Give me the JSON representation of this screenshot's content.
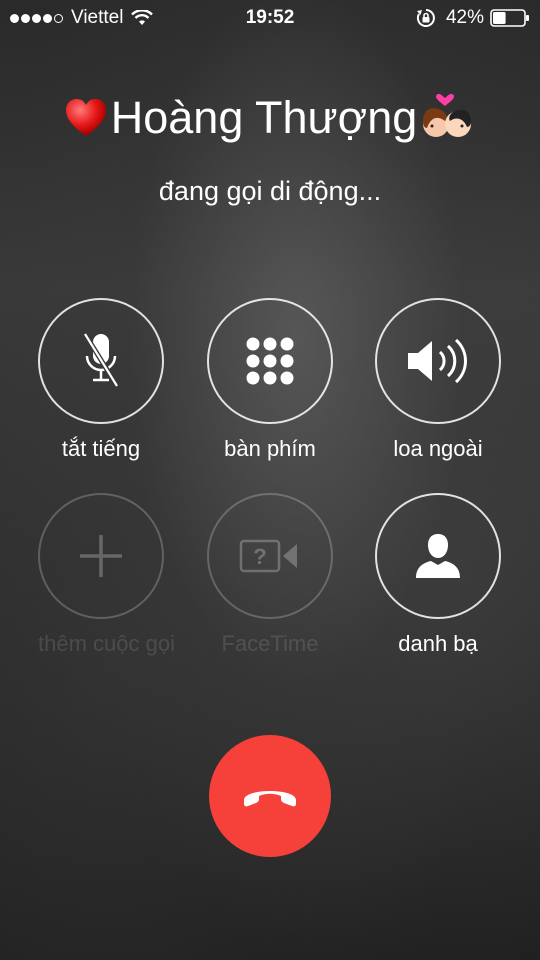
{
  "status_bar": {
    "signal_bars": 5,
    "signal_filled": 4,
    "carrier": "Viettel",
    "time": "19:52",
    "battery_percent": "42%",
    "battery_level": 0.42,
    "icons": [
      "wifi-icon",
      "rotation-lock-icon",
      "battery-icon"
    ]
  },
  "call": {
    "caller_name": "Hoàng Thượng",
    "caller_emoji_prefix": "heart-icon",
    "caller_emoji_suffix": "couple-kiss-icon",
    "status": "đang gọi di động..."
  },
  "controls": [
    {
      "id": "mute",
      "label": "tắt tiếng",
      "icon": "mute-mic-icon",
      "enabled": true
    },
    {
      "id": "keypad",
      "label": "bàn phím",
      "icon": "keypad-icon",
      "enabled": true
    },
    {
      "id": "speaker",
      "label": "loa ngoài",
      "icon": "speaker-icon",
      "enabled": true
    },
    {
      "id": "add_call",
      "label": "thêm cuộc gọi",
      "icon": "plus-icon",
      "enabled": false
    },
    {
      "id": "facetime",
      "label": "FaceTime",
      "icon": "facetime-icon",
      "enabled": false
    },
    {
      "id": "contacts",
      "label": "danh bạ",
      "icon": "contact-icon",
      "enabled": true
    }
  ],
  "end_call": {
    "icon": "end-call-icon",
    "color": "#f5413a"
  }
}
